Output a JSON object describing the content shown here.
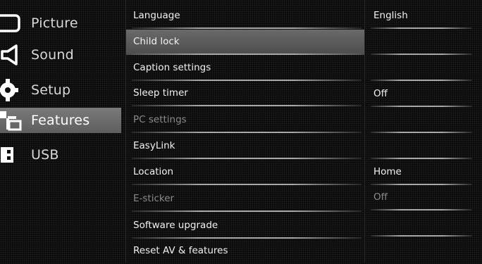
{
  "nav": {
    "items": [
      {
        "label": "Picture",
        "icon": "picture-icon"
      },
      {
        "label": "Sound",
        "icon": "sound-icon"
      },
      {
        "label": "Setup",
        "icon": "setup-gear-icon"
      },
      {
        "label": "Features",
        "icon": "features-icon",
        "active": true
      },
      {
        "label": "USB",
        "icon": "usb-icon"
      }
    ]
  },
  "menu": {
    "items": [
      {
        "label": "Language"
      },
      {
        "label": "Child lock"
      },
      {
        "label": "Caption settings"
      },
      {
        "label": "Sleep timer"
      },
      {
        "label": "PC settings"
      },
      {
        "label": "EasyLink"
      },
      {
        "label": "Location"
      },
      {
        "label": "E-sticker"
      },
      {
        "label": "Software upgrade"
      },
      {
        "label": "Reset AV & features"
      }
    ]
  },
  "values": {
    "items": [
      {
        "label": "English"
      },
      {
        "label": ""
      },
      {
        "label": ""
      },
      {
        "label": "Off"
      },
      {
        "label": ""
      },
      {
        "label": ""
      },
      {
        "label": "Home"
      },
      {
        "label": "Off"
      },
      {
        "label": ""
      }
    ]
  },
  "colors": {
    "background": "#0c0c0c",
    "highlight": "#6a6a6a",
    "text": "#f2f2f2",
    "disabled_text": "#8a8a8a"
  }
}
